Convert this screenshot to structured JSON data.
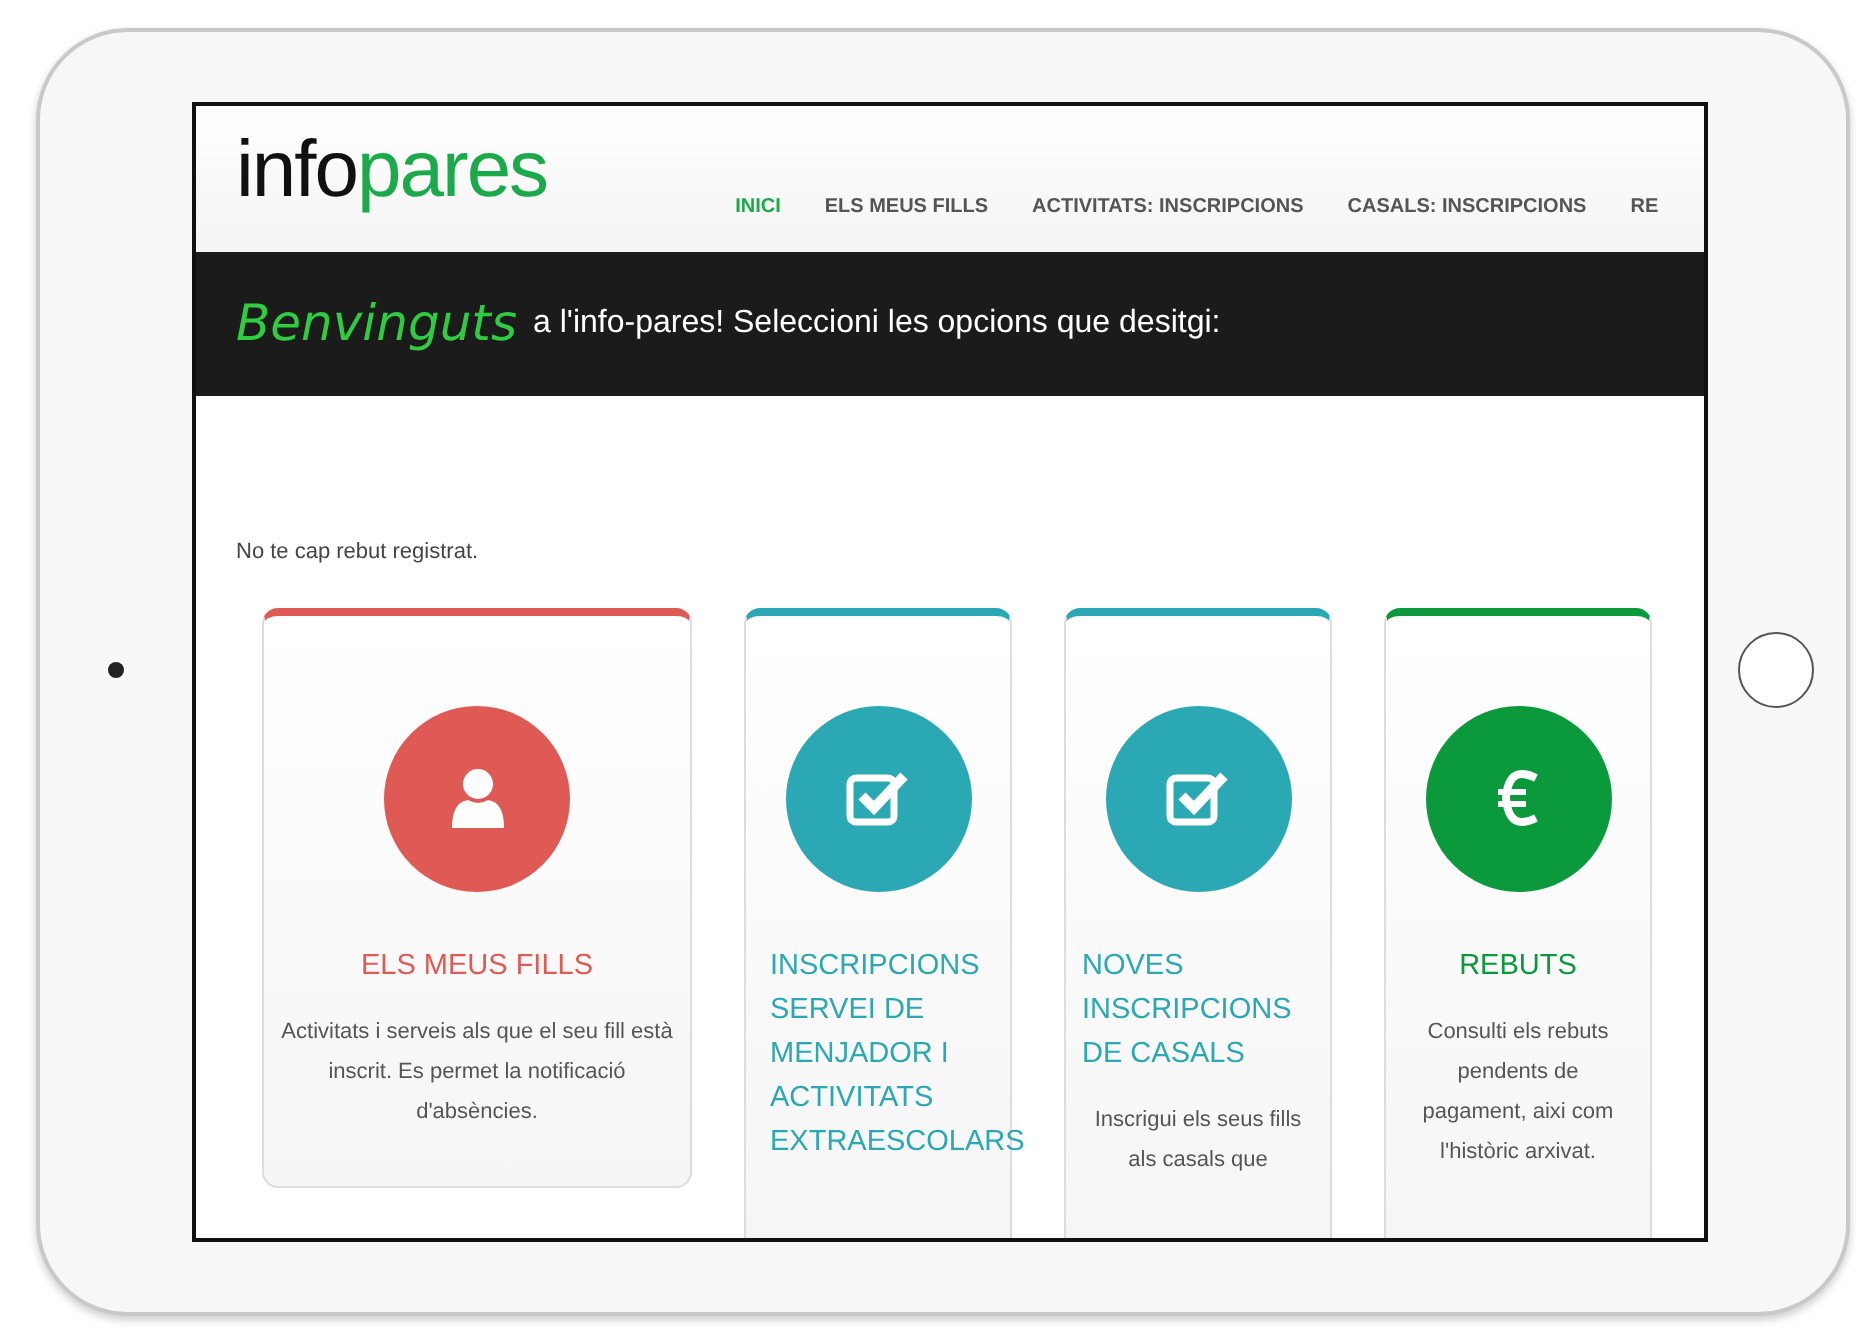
{
  "logo": {
    "part_1": "info",
    "part_2": "pares"
  },
  "nav": [
    {
      "label": "INICI",
      "selected": true
    },
    {
      "label": "ELS MEUS FILLS",
      "selected": false
    },
    {
      "label": "ACTIVITATS: INSCRIPCIONS",
      "selected": false
    },
    {
      "label": "CASALS: INSCRIPCIONS",
      "selected": false
    },
    {
      "label": "RE",
      "selected": false
    }
  ],
  "banner": {
    "greeting": "Benvinguts",
    "text": "a l'info-pares! Seleccioni les opcions que desitgi:"
  },
  "notice": "No te cap rebut registrat.",
  "cards": [
    {
      "kind": "person",
      "color": "#e05a55",
      "title": "ELS MEUS FILLS",
      "description": "Activitats i serveis als que el seu fill està inscrit. Es permet la notificació d'absències."
    },
    {
      "kind": "check",
      "color": "#2aa8b3",
      "title": "INSCRIPCIONS SERVEI DE MENJADOR I ACTIVITATS EXTRAESCOLARS"
    },
    {
      "kind": "check",
      "color": "#2aa8b3",
      "title": "NOVES INSCRIPCIONS DE CASALS",
      "description": "Inscrigui els seus fills als casals que"
    },
    {
      "kind": "euro",
      "color": "#0a9a3c",
      "title": "REBUTS",
      "description": "Consulti els rebuts pendents de pagament, aixi com l'històric arxivat."
    }
  ]
}
